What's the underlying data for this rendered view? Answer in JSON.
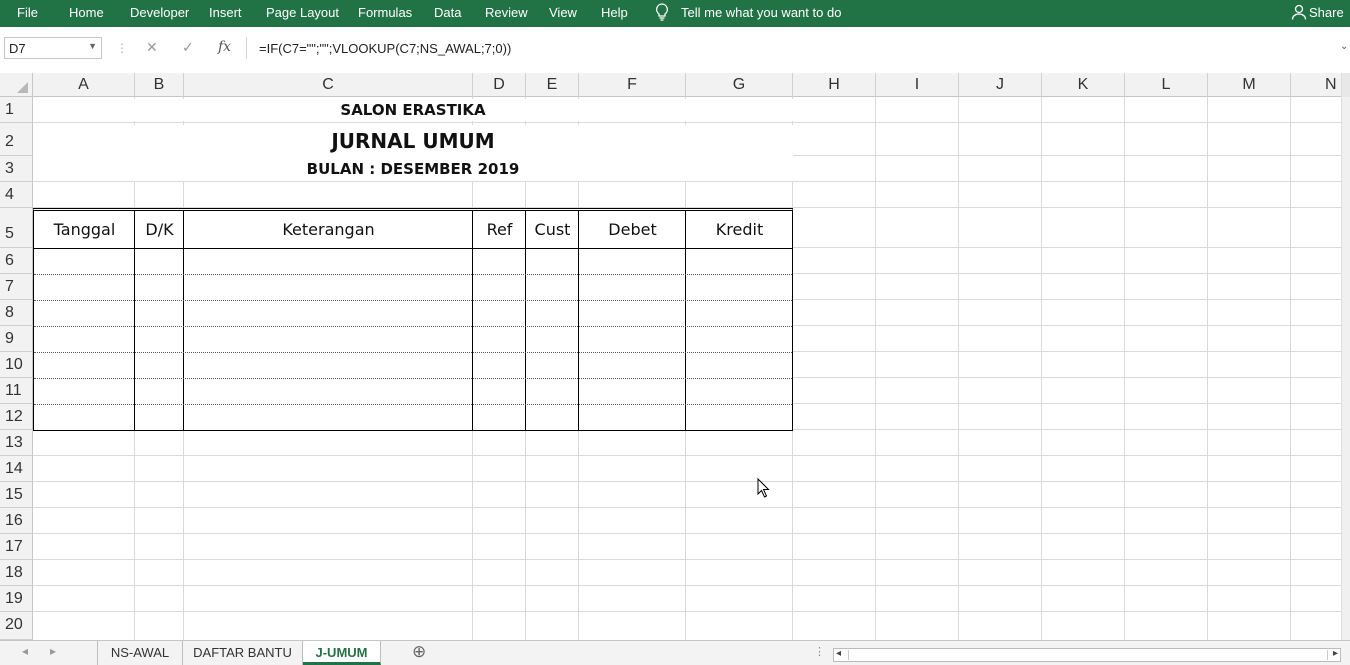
{
  "ribbon": {
    "menu": [
      "File",
      "Home",
      "Developer",
      "Insert",
      "Page Layout",
      "Formulas",
      "Data",
      "Review",
      "View",
      "Help"
    ],
    "tell_me": "Tell me what you want to do",
    "share": "Share"
  },
  "formula_bar": {
    "name_box": "D7",
    "cancel_icon": "✕",
    "enter_icon": "✓",
    "fx_label": "fx",
    "formula": "=IF(C7=\"\";\"\";VLOOKUP(C7;NS_AWAL;7;0))"
  },
  "columns": [
    "A",
    "B",
    "C",
    "D",
    "E",
    "F",
    "G",
    "H",
    "I",
    "J",
    "K",
    "L",
    "M",
    "N"
  ],
  "rows": [
    "1",
    "2",
    "3",
    "4",
    "5",
    "6",
    "7",
    "8",
    "9",
    "10",
    "11",
    "12",
    "13",
    "14",
    "15",
    "16",
    "17",
    "18",
    "19",
    "20"
  ],
  "sheet": {
    "title": "SALON ERASTIKA",
    "subtitle": "JURNAL UMUM",
    "period": "BULAN : DESEMBER 2019",
    "headers": [
      "Tanggal",
      "D/K",
      "Keterangan",
      "Ref",
      "Cust",
      "Debet",
      "Kredit"
    ]
  },
  "tabs": {
    "items": [
      "NS-AWAL",
      "DAFTAR BANTU",
      "J-UMUM"
    ],
    "active": "J-UMUM",
    "add_label": "⊕"
  },
  "colors": {
    "ribbon": "#217346",
    "gridline": "#d9d9d9",
    "header_bg": "#f2f2f2"
  }
}
